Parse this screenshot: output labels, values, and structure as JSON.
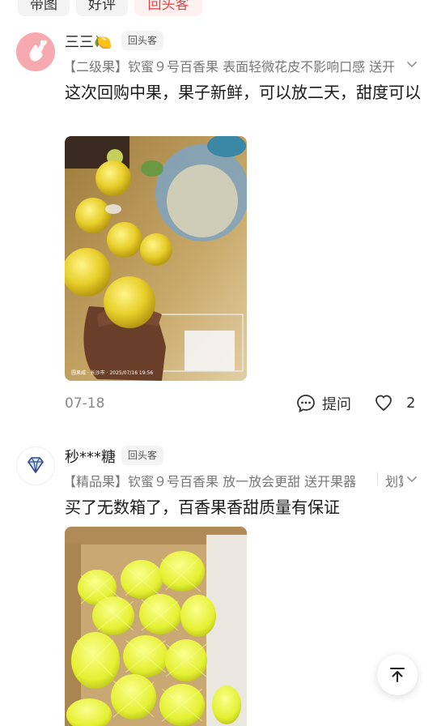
{
  "tabs": [
    {
      "label": "带图",
      "active": false
    },
    {
      "label": "好评",
      "active": false
    },
    {
      "label": "回头客",
      "active": true
    }
  ],
  "reviews": [
    {
      "user": "三三🍋",
      "badge": "回头客",
      "spec": "【二级果】钦蜜９号百香果 表面轻微花皮不影响口感 送开",
      "text": "这次回购中果，果子新鲜，可以放二天，甜度可以",
      "photo_watermark": "圆果威 · 长沙市 · 2025/07/16 19:56",
      "date": "07-18",
      "ask_label": "提问",
      "likes": "2"
    },
    {
      "user": "秒***糖",
      "badge": "回头客",
      "spec": "【精品果】钦蜜９号百香果 放一放会更甜 送开果器",
      "spec_more": "划算",
      "text": "买了无数箱了，百香果香甜质量有保证"
    }
  ],
  "colors": {
    "accent": "#e8403e",
    "avatar1": "#f7a9b0",
    "avatar2_icon": "#3a4a8a"
  },
  "icons": {
    "ask": "question-bubble-icon",
    "like": "heart-icon",
    "scroll_top": "arrow-up-to-top-icon"
  }
}
